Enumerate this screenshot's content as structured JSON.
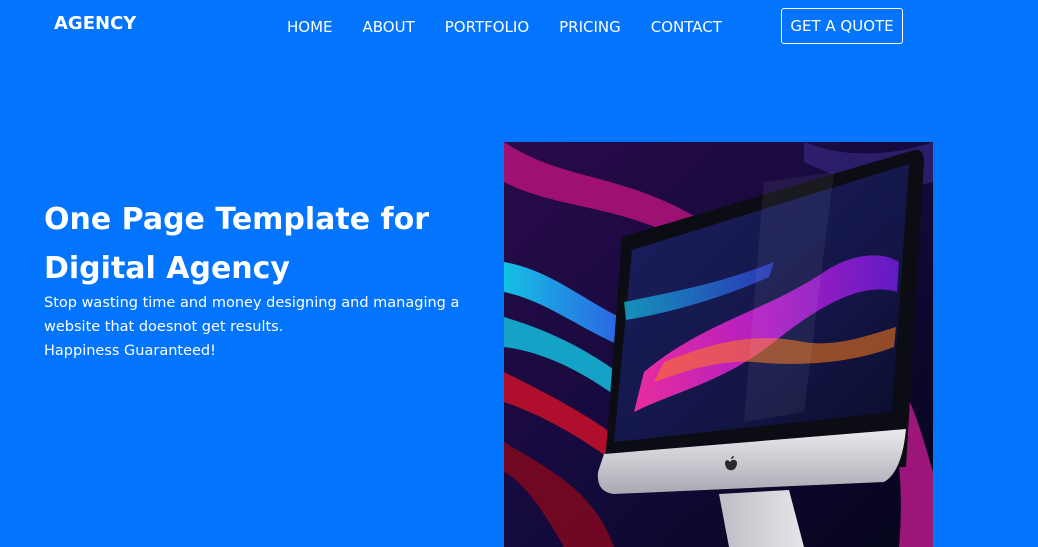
{
  "nav": {
    "brand": "AGENCY",
    "links": [
      "HOME",
      "ABOUT",
      "PORTFOLIO",
      "PRICING",
      "CONTACT"
    ],
    "cta": "GET A QUOTE"
  },
  "hero": {
    "title_line1": "One Page Template for",
    "title_line2": "Digital Agency",
    "subtitle": "Stop wasting time and money designing and managing a website that doesnot get results.",
    "tagline": "Happiness Guaranteed!"
  },
  "colors": {
    "background": "#0274fe",
    "text": "#ffffff"
  },
  "icons": {
    "hero_image": "imac-computer-illustration",
    "logo": "apple-logo-icon"
  }
}
